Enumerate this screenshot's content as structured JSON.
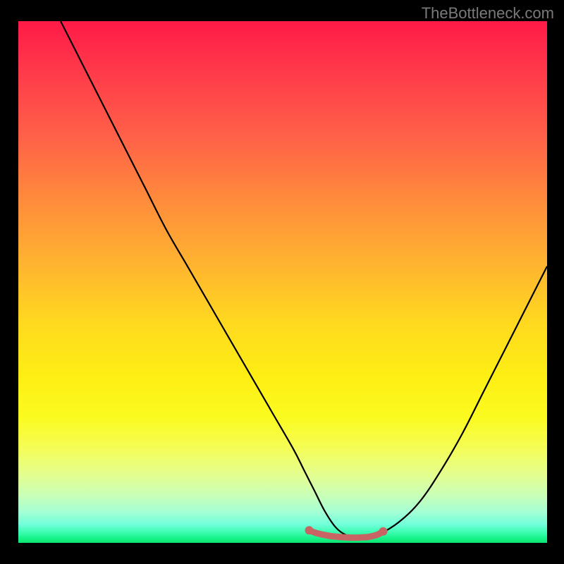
{
  "attribution": "TheBottleneck.com",
  "chart_data": {
    "type": "line",
    "title": "",
    "xlabel": "",
    "ylabel": "",
    "xlim": [
      0,
      100
    ],
    "ylim": [
      0,
      100
    ],
    "series": [
      {
        "name": "bottleneck-curve",
        "x": [
          8,
          12,
          16,
          20,
          24,
          28,
          32,
          36,
          40,
          44,
          48,
          52,
          54,
          56,
          58,
          60,
          62,
          64,
          66,
          68,
          72,
          76,
          80,
          84,
          88,
          92,
          96,
          100
        ],
        "y": [
          100,
          92,
          84,
          76,
          68,
          60,
          53,
          46,
          39,
          32,
          25,
          18,
          14,
          10,
          6,
          3,
          1.5,
          1,
          1,
          1.5,
          4,
          8,
          14,
          21,
          29,
          37,
          45,
          53
        ]
      },
      {
        "name": "optimal-zone-marker",
        "x": [
          55,
          56,
          57,
          58,
          59,
          60,
          61,
          62,
          63,
          64,
          65,
          66,
          67,
          68,
          69
        ],
        "y": [
          2.4,
          2.0,
          1.7,
          1.5,
          1.3,
          1.2,
          1.1,
          1.05,
          1.0,
          1.0,
          1.05,
          1.1,
          1.3,
          1.6,
          2.2
        ]
      }
    ],
    "colors": {
      "curve": "#000000",
      "marker": "#c86464",
      "gradient_top": "#ff1a48",
      "gradient_mid": "#ffd91f",
      "gradient_bottom": "#1af58e"
    }
  }
}
